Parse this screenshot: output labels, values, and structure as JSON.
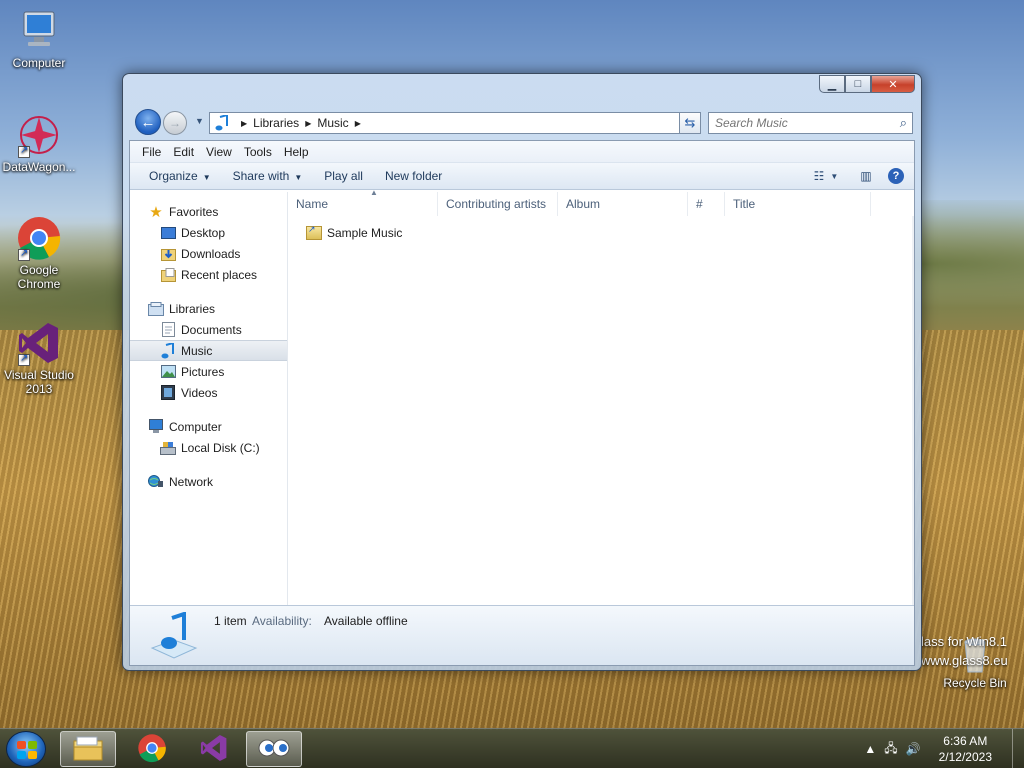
{
  "desktop": {
    "icons": [
      {
        "label": "Computer"
      },
      {
        "label": "DataWagon..."
      },
      {
        "label": "Google Chrome"
      },
      {
        "label": "Visual Studio 2013"
      },
      {
        "label": "Recycle Bin"
      }
    ],
    "watermark_line1": "lass for Win8.1",
    "watermark_line2": "www.glass8.eu"
  },
  "window": {
    "controls": {
      "minimize": "▁",
      "maximize": "□",
      "close": "✕"
    },
    "breadcrumb": [
      "Libraries",
      "Music"
    ],
    "search_placeholder": "Search Music",
    "menu": [
      "File",
      "Edit",
      "View",
      "Tools",
      "Help"
    ],
    "commands": {
      "organize": "Organize",
      "share_with": "Share with",
      "play_all": "Play all",
      "new_folder": "New folder"
    },
    "nav": {
      "favorites": {
        "label": "Favorites",
        "items": [
          "Desktop",
          "Downloads",
          "Recent places"
        ]
      },
      "libraries": {
        "label": "Libraries",
        "items": [
          "Documents",
          "Music",
          "Pictures",
          "Videos"
        ],
        "selected": "Music"
      },
      "computer": {
        "label": "Computer",
        "items": [
          "Local Disk (C:)"
        ]
      },
      "network": {
        "label": "Network"
      }
    },
    "columns": [
      "Name",
      "Contributing artists",
      "Album",
      "#",
      "Title"
    ],
    "files": [
      {
        "name": "Sample Music"
      }
    ],
    "details": {
      "count": "1 item",
      "availability_label": "Availability:",
      "availability_value": "Available offline"
    }
  },
  "taskbar": {
    "clock_time": "6:36 AM",
    "clock_date": "2/12/2023",
    "pinned": [
      "explorer-icon",
      "chrome-icon",
      "visual-studio-icon",
      "eyes-app-icon"
    ]
  },
  "colors": {
    "accent": "#1f5fbf",
    "selection": "#d9e0e8",
    "close": "#c7412b"
  }
}
